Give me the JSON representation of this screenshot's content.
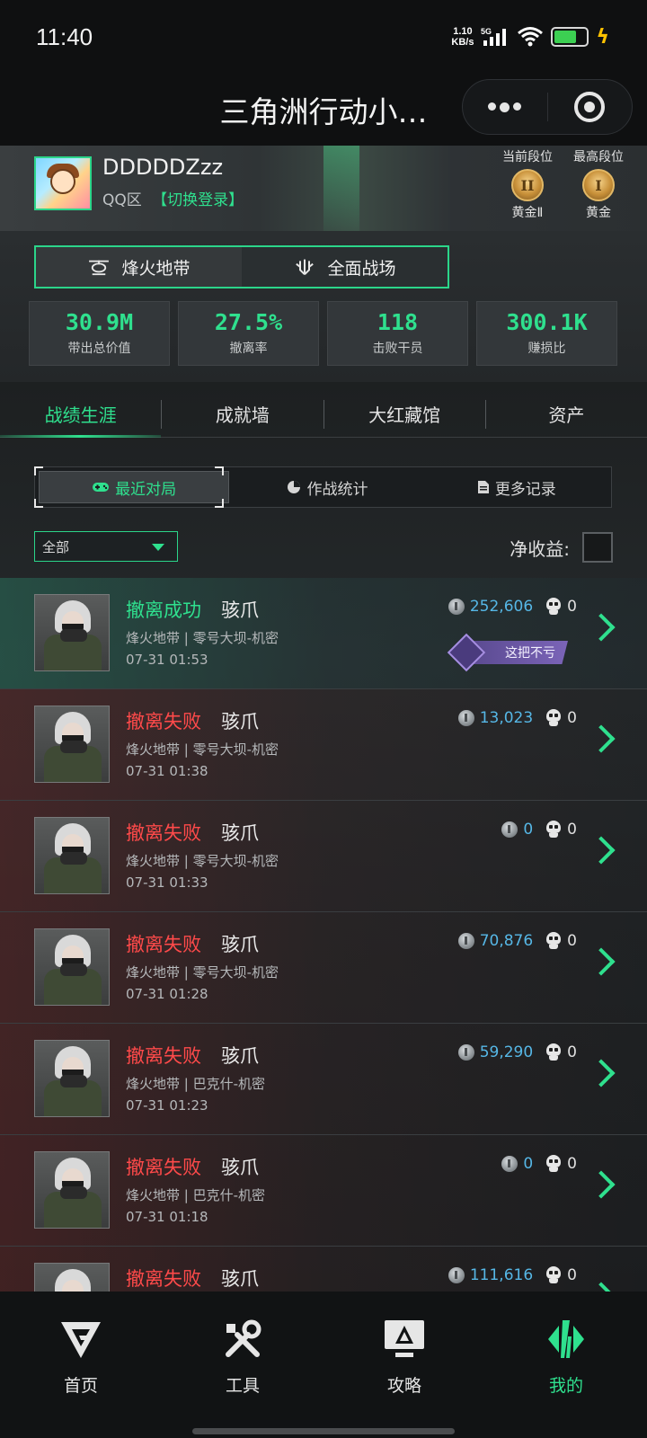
{
  "status_bar": {
    "time": "11:40",
    "net_speed_value": "1.10",
    "net_speed_unit": "KB/s",
    "network": "5G",
    "battery_level": 0.7,
    "icons": [
      "signal-icon",
      "wifi-icon",
      "battery-icon",
      "charging-bolt-icon"
    ]
  },
  "title_bar": {
    "title": "三角洲行动小…",
    "icons": [
      "more-dots-icon",
      "close-target-icon"
    ]
  },
  "profile": {
    "username": "DDDDDZzz",
    "server": "QQ区",
    "switch_login": "【切换登录】",
    "current_rank_label": "当前段位",
    "current_rank_badge": "II",
    "current_rank_name": "黄金Ⅱ",
    "highest_rank_label": "最高段位",
    "highest_rank_badge": "I",
    "highest_rank_name": "黄金"
  },
  "modes": [
    {
      "label": "烽火地带",
      "active": true,
      "icon": "helicopter-icon"
    },
    {
      "label": "全面战场",
      "active": false,
      "icon": "battle-icon"
    }
  ],
  "stats": [
    {
      "value": "30.9M",
      "label": "带出总价值"
    },
    {
      "value": "27.5%",
      "label": "撤离率"
    },
    {
      "value": "118",
      "label": "击败干员"
    },
    {
      "value": "300.1K",
      "label": "赚损比"
    }
  ],
  "main_tabs": [
    {
      "label": "战绩生涯",
      "active": true
    },
    {
      "label": "成就墙",
      "active": false
    },
    {
      "label": "大红藏馆",
      "active": false
    },
    {
      "label": "资产",
      "active": false
    }
  ],
  "sub_tabs": [
    {
      "label": "最近对局",
      "icon": "gamepad-icon",
      "active": true
    },
    {
      "label": "作战统计",
      "icon": "pie-chart-icon",
      "active": false
    },
    {
      "label": "更多记录",
      "icon": "document-icon",
      "active": false
    }
  ],
  "filter": {
    "selected": "全部",
    "net_income_label": "净收益:"
  },
  "records": [
    {
      "status": "撤离成功",
      "result": "success",
      "operator": "骇爪",
      "map": "烽火地带 | 零号大坝-机密",
      "time": "07-31 01:53",
      "value": "252,606",
      "kills": "0",
      "tag": "这把不亏"
    },
    {
      "status": "撤离失败",
      "result": "fail",
      "operator": "骇爪",
      "map": "烽火地带 | 零号大坝-机密",
      "time": "07-31 01:38",
      "value": "13,023",
      "kills": "0"
    },
    {
      "status": "撤离失败",
      "result": "fail",
      "operator": "骇爪",
      "map": "烽火地带 | 零号大坝-机密",
      "time": "07-31 01:33",
      "value": "0",
      "kills": "0"
    },
    {
      "status": "撤离失败",
      "result": "fail",
      "operator": "骇爪",
      "map": "烽火地带 | 零号大坝-机密",
      "time": "07-31 01:28",
      "value": "70,876",
      "kills": "0"
    },
    {
      "status": "撤离失败",
      "result": "fail",
      "operator": "骇爪",
      "map": "烽火地带 | 巴克什-机密",
      "time": "07-31 01:23",
      "value": "59,290",
      "kills": "0"
    },
    {
      "status": "撤离失败",
      "result": "fail",
      "operator": "骇爪",
      "map": "烽火地带 | 巴克什-机密",
      "time": "07-31 01:18",
      "value": "0",
      "kills": "0"
    },
    {
      "status": "撤离失败",
      "result": "fail",
      "operator": "骇爪",
      "map": "",
      "time": "",
      "value": "111,616",
      "kills": "0"
    }
  ],
  "bottom_nav": [
    {
      "label": "首页",
      "icon": "home-logo-icon",
      "active": false
    },
    {
      "label": "工具",
      "icon": "tools-icon",
      "active": false
    },
    {
      "label": "攻略",
      "icon": "guide-icon",
      "active": false
    },
    {
      "label": "我的",
      "icon": "profile-logo-icon",
      "active": true
    }
  ],
  "colors": {
    "accent": "#2fe08e",
    "fail": "#ff4a4a",
    "value": "#56b7e6",
    "tag": "#7b64b8"
  }
}
